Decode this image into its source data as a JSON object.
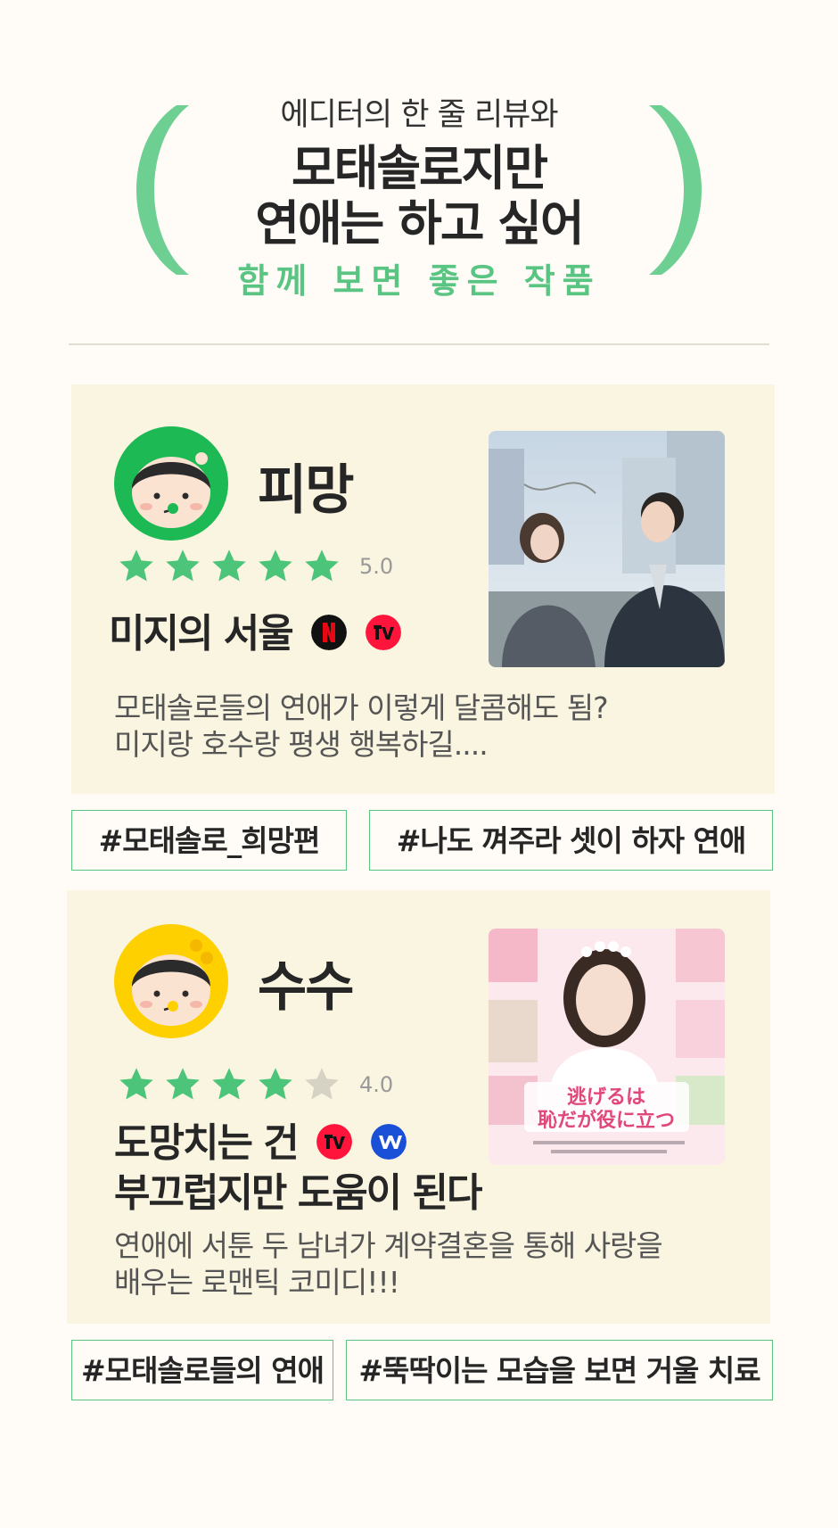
{
  "header": {
    "pre_title": "에디터의 한 줄 리뷰와",
    "title_line1": "모태솔로지만",
    "title_line2": "연애는 하고 싶어",
    "subtitle": "함께 보면 좋은 작품",
    "accent_color": "#5ac582"
  },
  "reviews": [
    {
      "reviewer": "피망",
      "avatar_color": "#1db954",
      "rating": 5,
      "score_text": "5.0",
      "work_title_line1": "미지의 서울",
      "work_title_line2": "",
      "platforms": [
        "netflix-icon",
        "tving-icon"
      ],
      "description_line1": "모태솔로들의 연애가 이렇게 달콤해도 됨?",
      "description_line2": "미지랑 호수랑 평생 행복하길....",
      "tags": [
        "#모태솔로_희망편",
        "#나도 껴주라 셋이 하자 연애"
      ]
    },
    {
      "reviewer": "수수",
      "avatar_color": "#ffd000",
      "rating": 4,
      "score_text": "4.0",
      "work_title_line1": "도망치는 건",
      "work_title_line2": "부끄럽지만 도움이 된다",
      "platforms": [
        "tving-icon",
        "wavve-icon"
      ],
      "description_line1": "연애에 서툰 두 남녀가 계약결혼을 통해 사랑을",
      "description_line2": "배우는 로맨틱 코미디!!!",
      "poster_title_line1": "逃げるは",
      "poster_title_line2": "恥だが役に立つ",
      "tags": [
        "#모태솔로들의 연애",
        "#뚝딱이는 모습을 보면 거울 치료"
      ]
    }
  ]
}
